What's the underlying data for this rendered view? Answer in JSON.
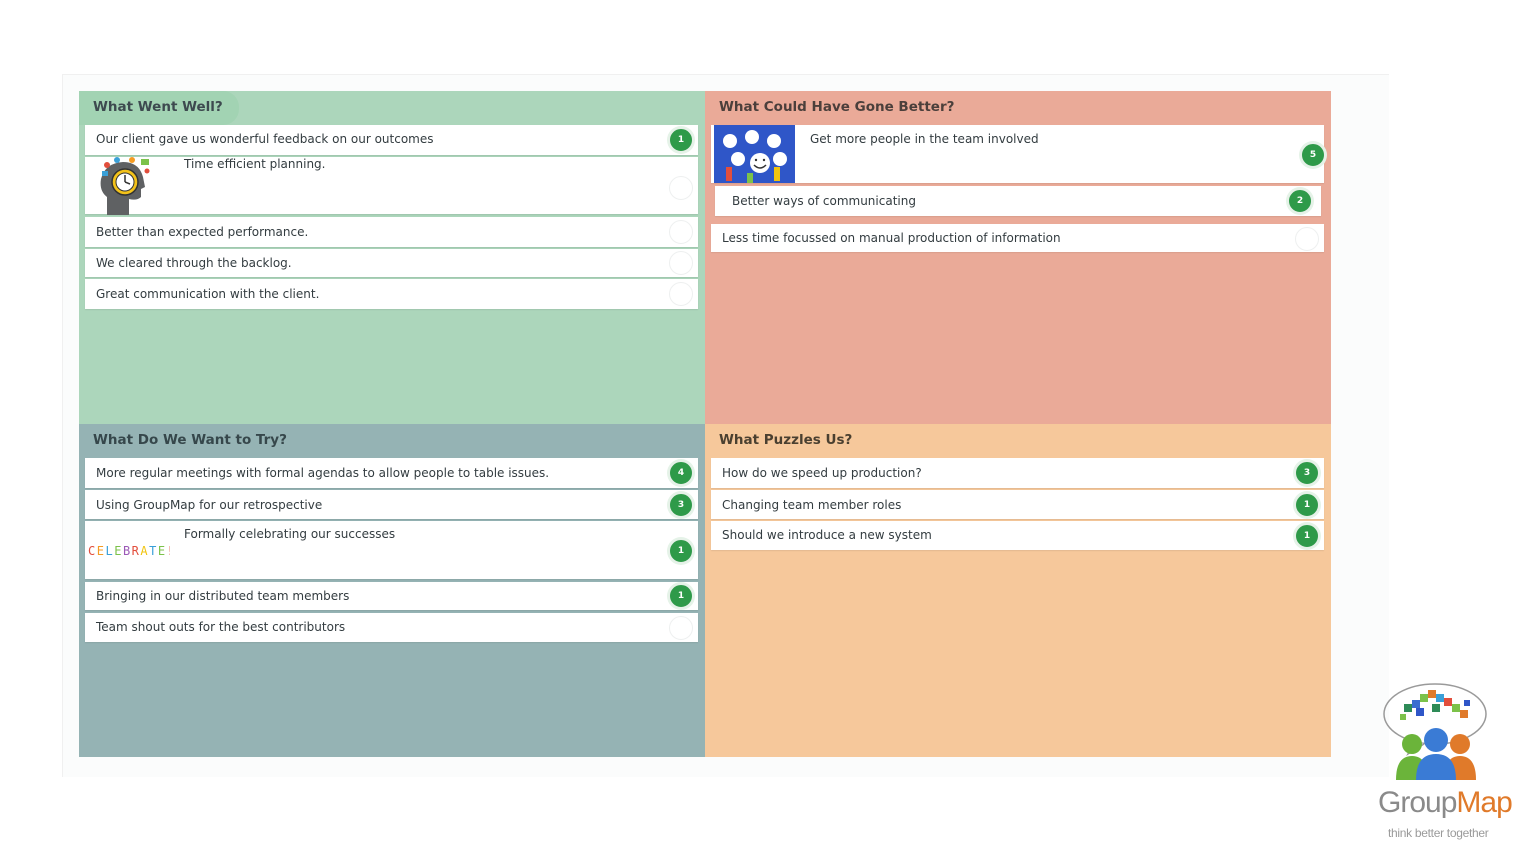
{
  "quadrants": {
    "went_well": {
      "title": "What Went Well?",
      "cards": [
        {
          "text": "Our client gave us wonderful feedback on our outcomes",
          "votes": "1"
        },
        {
          "text": "Time efficient planning.",
          "votes": ""
        },
        {
          "text": "Better than expected performance.",
          "votes": ""
        },
        {
          "text": "We cleared through the backlog.",
          "votes": ""
        },
        {
          "text": "Great communication with the client.",
          "votes": ""
        }
      ]
    },
    "could_be_better": {
      "title": "What Could Have Gone Better?",
      "cards": [
        {
          "text": "Get more people in the team involved",
          "votes": "5"
        },
        {
          "text": "Better ways of communicating",
          "votes": "2"
        },
        {
          "text": "Less time focussed on manual production of information",
          "votes": ""
        }
      ]
    },
    "want_to_try": {
      "title": "What Do We Want to Try?",
      "cards": [
        {
          "text": "More regular meetings with formal agendas to allow people to table issues.",
          "votes": "4"
        },
        {
          "text": "Using GroupMap for our retrospective",
          "votes": "3"
        },
        {
          "text": "Formally celebrating our successes",
          "votes": "1",
          "image_text": "CELEBRATE!"
        },
        {
          "text": "Bringing in our distributed team members",
          "votes": "1"
        },
        {
          "text": "Team shout outs for the best contributors",
          "votes": ""
        }
      ]
    },
    "puzzles": {
      "title": "What Puzzles Us?",
      "cards": [
        {
          "text": "How do we speed up production?",
          "votes": "3"
        },
        {
          "text": "Changing team member roles",
          "votes": "1"
        },
        {
          "text": "Should we introduce a new system",
          "votes": "1"
        }
      ]
    }
  },
  "logo": {
    "name_part1": "Group",
    "name_part2": "Map",
    "tagline": "think better together"
  },
  "colors": {
    "went_well": "#acd6bb",
    "could_be_better": "#eaaa98",
    "want_to_try": "#95b3b4",
    "puzzles": "#f6c89b",
    "vote_badge": "#2e9a49",
    "logo_orange": "#e07a2a"
  }
}
